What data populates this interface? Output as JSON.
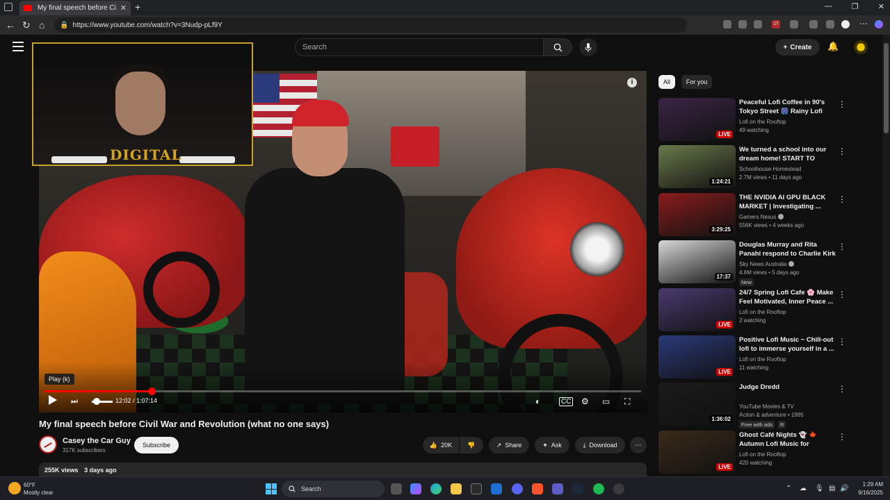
{
  "browser": {
    "tab_title": "My final speech before Civil War",
    "url": "https://www.youtube.com/watch?v=3Nudp-pLf9Y",
    "new_tab": "+",
    "tab_close": "✕",
    "ext_badge": "17"
  },
  "header": {
    "search_placeholder": "Search",
    "create_label": "Create"
  },
  "player": {
    "tooltip": "Play (k)",
    "time": "12:02 / 1:07:14",
    "progress": 0.179
  },
  "webcam": {
    "logo": "DIGITAL"
  },
  "video": {
    "title": "My final speech before Civil War and Revolution (what no one says)",
    "channel": "Casey the Car Guy",
    "subscribers": "317K subscribers",
    "subscribe_label": "Subscribe",
    "likes": "20K",
    "share_label": "Share",
    "ask_label": "Ask",
    "download_label": "Download",
    "views": "255K views",
    "age": "3 days ago"
  },
  "sidebar": {
    "chips": [
      "All",
      "For you"
    ],
    "recommendations": [
      {
        "title": "Peaceful Lofi Coffee in 90's Tokyo Street 🎆 Rainy Lofi Hip...",
        "channel": "Lofi on the Rooftop",
        "meta": "49 watching",
        "badge": "LIVE",
        "live": true,
        "color": "#3a2545"
      },
      {
        "title": "We turned a school into our dream home! START TO FINISH",
        "channel": "Schoolhouse Homestead",
        "meta": "2.7M views • 11 days ago",
        "badge": "1:24:21",
        "live": false,
        "color": "#6a7a4a"
      },
      {
        "title": "THE NVIDIA AI GPU BLACK MARKET | Investigating ...",
        "channel": "Gamers Nexus",
        "meta": "556K views • 4 weeks ago",
        "badge": "3:29:25",
        "live": false,
        "verified": true,
        "color": "#8a1c1c"
      },
      {
        "title": "Douglas Murray and Rita Panahi respond to Charlie Kirk ...",
        "channel": "Sky News Australia",
        "meta": "4.6M views • 5 days ago",
        "badge": "17:37",
        "live": false,
        "verified": true,
        "tag": "New",
        "color": "#d8d8d8"
      },
      {
        "title": "24/7 Spring Lofi Cafe 🌸 Make Feel Motivated, Inner Peace ...",
        "channel": "Lofi on the Rooftop",
        "meta": "2 watching",
        "badge": "LIVE",
        "live": true,
        "color": "#4a3a70"
      },
      {
        "title": "Positive Lofi Music ~ Chill-out lofi to immerse yourself in a ...",
        "channel": "Lofi on the Rooftop",
        "meta": "11 watching",
        "badge": "LIVE",
        "live": true,
        "color": "#2a3a7a"
      },
      {
        "title": "Judge Dredd",
        "channel": "YouTube Movies & TV",
        "meta": "Action & adventure • 1995",
        "badge": "1:36:02",
        "live": false,
        "tag": "Free with ads",
        "tag2": "R",
        "color": "#1a1a1a"
      },
      {
        "title": "Ghost Café Nights 👻 🍁 Autumn Lofi Music for Peacef...",
        "channel": "Lofi on the Rooftop",
        "meta": "420 watching",
        "badge": "LIVE",
        "live": true,
        "color": "#3a2a1a"
      }
    ]
  },
  "taskbar": {
    "temp": "60°F",
    "weather": "Mostly clear",
    "search_label": "Search",
    "time": "1:29 AM",
    "date": "9/16/2025"
  },
  "colors": {
    "accent": "#ff0000",
    "bg": "#0f0f0f",
    "webcam_border": "#c9a227"
  }
}
